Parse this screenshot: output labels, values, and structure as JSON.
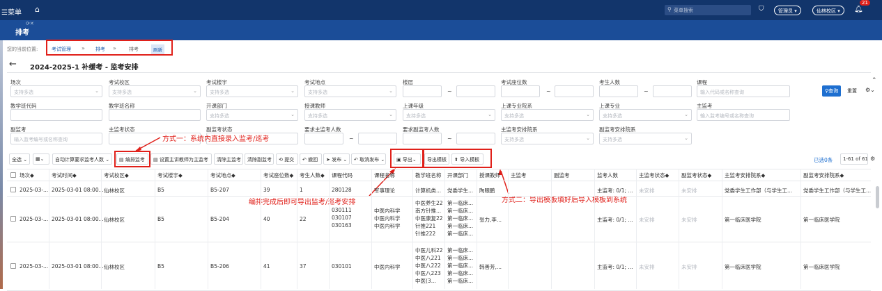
{
  "nav": {
    "menu": "菜单",
    "search_placeholder": "菜单搜索",
    "role": "管理员",
    "campus": "仙林校区",
    "badge": "21"
  },
  "module": {
    "title": "排考"
  },
  "breadcrumb": {
    "prefix": "您的当前位置:",
    "items": [
      "考试管理",
      "排考",
      "排考"
    ],
    "refresh": "刷新"
  },
  "page": {
    "title": "2024-2025-1 补缓考 - 监考安排"
  },
  "filters": {
    "row1": [
      {
        "label": "场次",
        "placeholder": "支持多选"
      },
      {
        "label": "考试校区",
        "placeholder": "支持多选"
      },
      {
        "label": "考试楼宇",
        "placeholder": "支持多选"
      },
      {
        "label": "考试地点",
        "placeholder": "支持多选"
      },
      {
        "label": "楼层"
      },
      {
        "label": "考试座位数"
      },
      {
        "label": "考生人数"
      },
      {
        "label": "课程",
        "placeholder": "输入代码或名称查询"
      }
    ],
    "row2": [
      {
        "label": "教学班代码"
      },
      {
        "label": "教学班名称"
      },
      {
        "label": "开课部门",
        "placeholder": "支持多选"
      },
      {
        "label": "授课教师",
        "placeholder": "支持多选"
      },
      {
        "label": "上课年级",
        "placeholder": "支持多选"
      },
      {
        "label": "上课专业院系",
        "placeholder": "支持多选"
      },
      {
        "label": "上课专业",
        "placeholder": "支持多选"
      },
      {
        "label": "主监考",
        "placeholder": "输入监考编号或名称查询"
      }
    ],
    "row3": [
      {
        "label": "副监考",
        "placeholder": "输入监考编号或名称查询"
      },
      {
        "label": "主监考状态"
      },
      {
        "label": "副监考状态"
      },
      {
        "label": "要求主监考人数"
      },
      {
        "label": "要求副监考人数"
      },
      {
        "label": "主监考安排院系",
        "placeholder": "支持多选"
      },
      {
        "label": "副监考安排院系",
        "placeholder": "支持多选"
      }
    ],
    "tilde": "~",
    "query": "查询",
    "reset": "重置"
  },
  "toolbar": {
    "select_all": "全选",
    "auto_calc": "自动计算要求监考人数",
    "edit": "编排监考",
    "set_main": "设置主讲教师为主监考",
    "clear_main": "清除主监考",
    "clear_sub": "清除副监考",
    "submit": "提交",
    "revoke": "撤回",
    "publish": "发布",
    "unpublish": "取消发布",
    "export": "导出",
    "export_tpl": "导出模板",
    "import_tpl": "导入模板",
    "selected": "已选0条",
    "pager": "1-61 of 61"
  },
  "annotations": {
    "a1": "方式一：系统内直接录入监考/巡考",
    "a2": "编排完成后即可导出监考/巡考安排",
    "a3": "方式二：导出模板填好后导入模板到系统"
  },
  "table": {
    "headers": [
      "场次◆",
      "考试时间◆",
      "考试校区◆",
      "考试楼宇◆",
      "考试地点◆",
      "考试座位数◆",
      "考生人数◆",
      "课程代码",
      "课程名称",
      "教学班名称",
      "开课部门",
      "授课教师",
      "主监考",
      "副监考",
      "监考人数",
      "主监考状态◆",
      "副监考状态◆",
      "主监考安排院系◆",
      "副监考安排院系◆"
    ],
    "rows": [
      {
        "session": "2025-03-...",
        "time": "2025-03-01 08:00...",
        "campus": "仙林校区",
        "building": "B5",
        "place": "B5-207",
        "seats": "39",
        "count": "1",
        "code": [
          "280128"
        ],
        "course": [
          "军事理论"
        ],
        "class": [
          "计算机类..."
        ],
        "dept": [
          "党委学生..."
        ],
        "teacher": "陶眼鹏",
        "num": "主监考: 0/1; ...",
        "mstat": "未安排",
        "sstat": "未安排",
        "mdept": "党委学生工作部（与学生工...",
        "sdept": "党委学生工作部（与学生工..."
      },
      {
        "session": "2025-03-...",
        "time": "2025-03-01 08:00...",
        "campus": "仙林校区",
        "building": "B5",
        "place": "B5-204",
        "seats": "40",
        "count": "22",
        "code": [
          "030111",
          "030107",
          "030163"
        ],
        "course": [
          "中医内科学",
          "中医内科学",
          "中医内科学"
        ],
        "class": [
          "中医养生22",
          "南方针推...",
          "中医康复22",
          "针推221",
          "针推222"
        ],
        "dept": [
          "第一临床...",
          "第一临床...",
          "第一临床...",
          "第一临床...",
          "第一临床..."
        ],
        "teacher": "张力,李...",
        "num": "主监考: 0/1; ...",
        "mstat": "未安排",
        "sstat": "未安排",
        "mdept": "第一临床医学院",
        "sdept": "第一临床医学院"
      },
      {
        "session": "2025-03-...",
        "time": "2025-03-01 08:00...",
        "campus": "仙林校区",
        "building": "B5",
        "place": "B5-206",
        "seats": "41",
        "count": "37",
        "code": [
          "030101"
        ],
        "course": [
          "中医内科学"
        ],
        "class": [
          "中医儿科22",
          "中医八221",
          "中医八222",
          "中医八223",
          "中医(3..."
        ],
        "dept": [
          "第一临床...",
          "第一临床...",
          "第一临床...",
          "第一临床...",
          "第一临床..."
        ],
        "teacher": "韩善芳,...",
        "num": "主监考: 0/1; ...",
        "mstat": "未安排",
        "sstat": "未安排",
        "mdept": "第一临床医学院",
        "sdept": "第一临床医学院"
      }
    ]
  }
}
